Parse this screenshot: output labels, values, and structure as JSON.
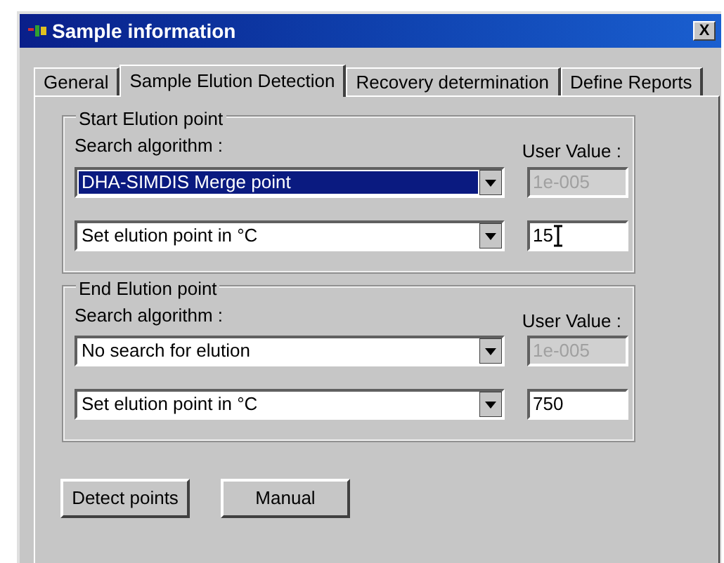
{
  "window": {
    "title": "Sample information",
    "close": "X"
  },
  "tabs": [
    {
      "label": "General",
      "selected": false
    },
    {
      "label": "Sample Elution Detection",
      "selected": true
    },
    {
      "label": "Recovery determination",
      "selected": false
    },
    {
      "label": "Define Reports",
      "selected": false
    }
  ],
  "groups": [
    {
      "title": "Start Elution point",
      "search_label": "Search algorithm :",
      "user_value_label": "User Value :",
      "algorithm": {
        "value": "DHA-SIMDIS Merge point",
        "highlighted": true
      },
      "user_value": {
        "value": "1e-005",
        "disabled": true
      },
      "mode": {
        "value": "Set elution point in °C"
      },
      "point_value": {
        "value": "15",
        "focused": true
      }
    },
    {
      "title": "End Elution point",
      "search_label": "Search algorithm :",
      "user_value_label": "User Value :",
      "algorithm": {
        "value": "No search for elution",
        "highlighted": false
      },
      "user_value": {
        "value": "1e-005",
        "disabled": true
      },
      "mode": {
        "value": "Set elution point in °C"
      },
      "point_value": {
        "value": "750",
        "focused": false
      }
    }
  ],
  "buttons": [
    "Detect points",
    "Manual"
  ]
}
